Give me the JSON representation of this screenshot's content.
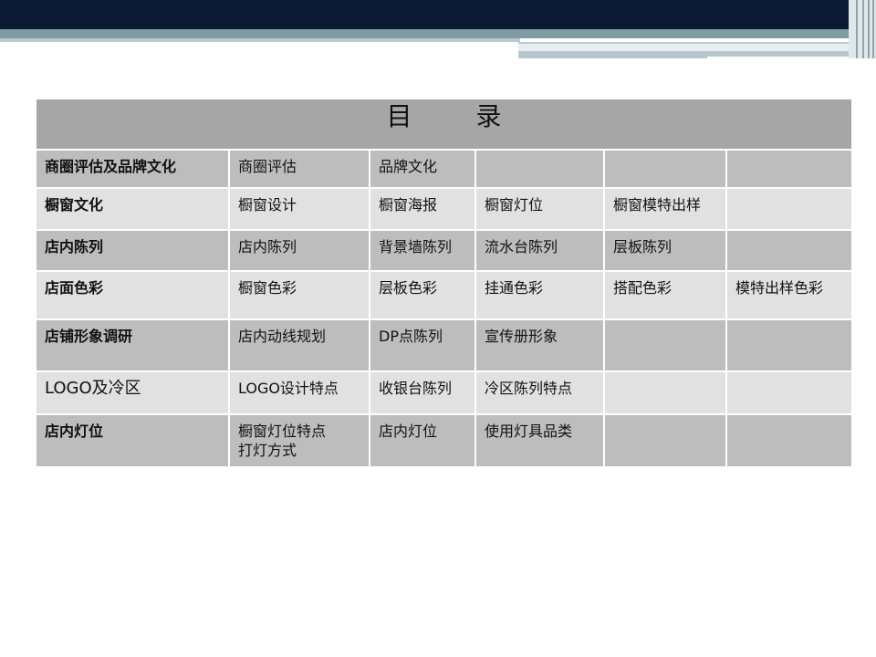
{
  "slide": {
    "title_left": "目",
    "title_right": "录"
  },
  "rows": [
    {
      "category": "商圈评估及品牌文化",
      "items": [
        "商圈评估",
        "品牌文化",
        "",
        "",
        ""
      ]
    },
    {
      "category": "橱窗文化",
      "items": [
        "橱窗设计",
        "橱窗海报",
        "橱窗灯位",
        "橱窗模特出样",
        ""
      ]
    },
    {
      "category": "店内陈列",
      "items": [
        "店内陈列",
        "背景墙陈列",
        "流水台陈列",
        "层板陈列",
        ""
      ]
    },
    {
      "category": "店面色彩",
      "items": [
        "橱窗色彩",
        "层板色彩",
        "挂通色彩",
        "搭配色彩",
        "模特出样色彩"
      ]
    },
    {
      "category": "店铺形象调研",
      "items": [
        "店内动线规划",
        "DP点陈列",
        "宣传册形象",
        "",
        ""
      ]
    },
    {
      "category": "LOGO及冷区",
      "items": [
        "LOGO设计特点",
        "收银台陈列",
        "冷区陈列特点",
        "",
        ""
      ]
    },
    {
      "category": "店内灯位",
      "items": [
        "橱窗灯位特点",
        "店内灯位",
        "使用灯具品类",
        "",
        ""
      ],
      "extra": "打灯方式"
    }
  ]
}
